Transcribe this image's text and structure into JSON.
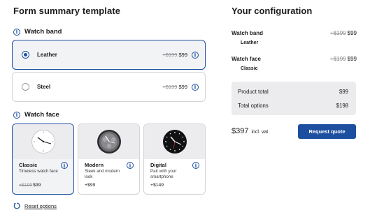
{
  "page_title": "Form summary template",
  "config_title": "Your configuration",
  "colors": {
    "accent": "#1d4fa0",
    "selected_bg": "#f2f3f5",
    "border": "#d4d4d8"
  },
  "watch_band": {
    "heading": "Watch band",
    "options": [
      {
        "label": "Leather",
        "old_price": "+$199",
        "price": "$99",
        "selected": true
      },
      {
        "label": "Steel",
        "old_price": "+$199",
        "price": "$99",
        "selected": false
      }
    ]
  },
  "watch_face": {
    "heading": "Watch face",
    "cards": [
      {
        "name": "Classic",
        "desc": "Timeless watch face",
        "old_price": "+$199",
        "price": "$99",
        "selected": true,
        "icon": "classic-watch-face-image"
      },
      {
        "name": "Modern",
        "desc": "Sleek and modern look",
        "old_price": "",
        "price": "+$99",
        "selected": false,
        "icon": "modern-watch-face-image"
      },
      {
        "name": "Digital",
        "desc": "Pair with your smartphone",
        "old_price": "",
        "price": "+$149",
        "selected": false,
        "icon": "digital-watch-face-image"
      }
    ]
  },
  "reset_label": "Reset options",
  "summary": {
    "items": [
      {
        "title": "Watch band",
        "sub": "Leather",
        "old_price": "+$199",
        "price": "$99"
      },
      {
        "title": "Watch face",
        "sub": "Classic",
        "old_price": "+$199",
        "price": "$99"
      }
    ],
    "product_total_label": "Product total",
    "product_total_value": "$99",
    "total_options_label": "Total options",
    "total_options_value": "$198",
    "grand_total": "$397",
    "vat_label": "incl. vat",
    "quote_button": "Request quote"
  }
}
